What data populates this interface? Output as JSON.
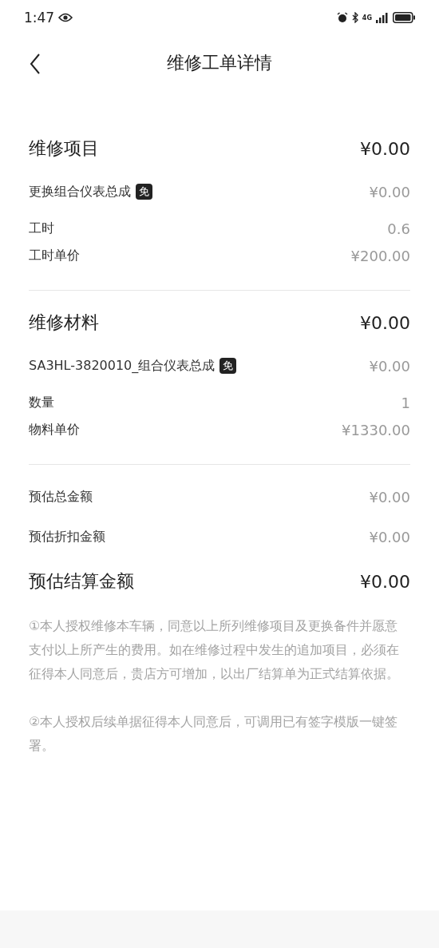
{
  "status_bar": {
    "time": "1:47",
    "network": "4G"
  },
  "header": {
    "title": "维修工单详情"
  },
  "sections": [
    {
      "heading": "维修项目",
      "amount": "¥0.00",
      "items": [
        {
          "kind": "main",
          "label": "更换组合仪表总成",
          "badge": "免",
          "value": "¥0.00"
        },
        {
          "kind": "detail",
          "label": "工时",
          "value": "0.6"
        },
        {
          "kind": "detail",
          "label": "工时单价",
          "value": "¥200.00"
        }
      ]
    },
    {
      "heading": "维修材料",
      "amount": "¥0.00",
      "items": [
        {
          "kind": "main",
          "label": "SA3HL-3820010_组合仪表总成",
          "badge": "免",
          "value": "¥0.00"
        },
        {
          "kind": "detail",
          "label": "数量",
          "value": "1"
        },
        {
          "kind": "detail",
          "label": "物料单价",
          "value": "¥1330.00"
        }
      ]
    }
  ],
  "totals": [
    {
      "label": "预估总金额",
      "value": "¥0.00"
    },
    {
      "label": "预估折扣金额",
      "value": "¥0.00"
    }
  ],
  "settlement": {
    "label": "预估结算金额",
    "value": "¥0.00"
  },
  "notes": [
    "①本人授权维修本车辆，同意以上所列维修项目及更换备件并愿意支付以上所产生的费用。如在维修过程中发生的追加项目，必须在征得本人同意后，贵店方可增加，以出厂结算单为正式结算依据。",
    "②本人授权后续单据征得本人同意后，可调用已有签字模版一键签署。"
  ]
}
